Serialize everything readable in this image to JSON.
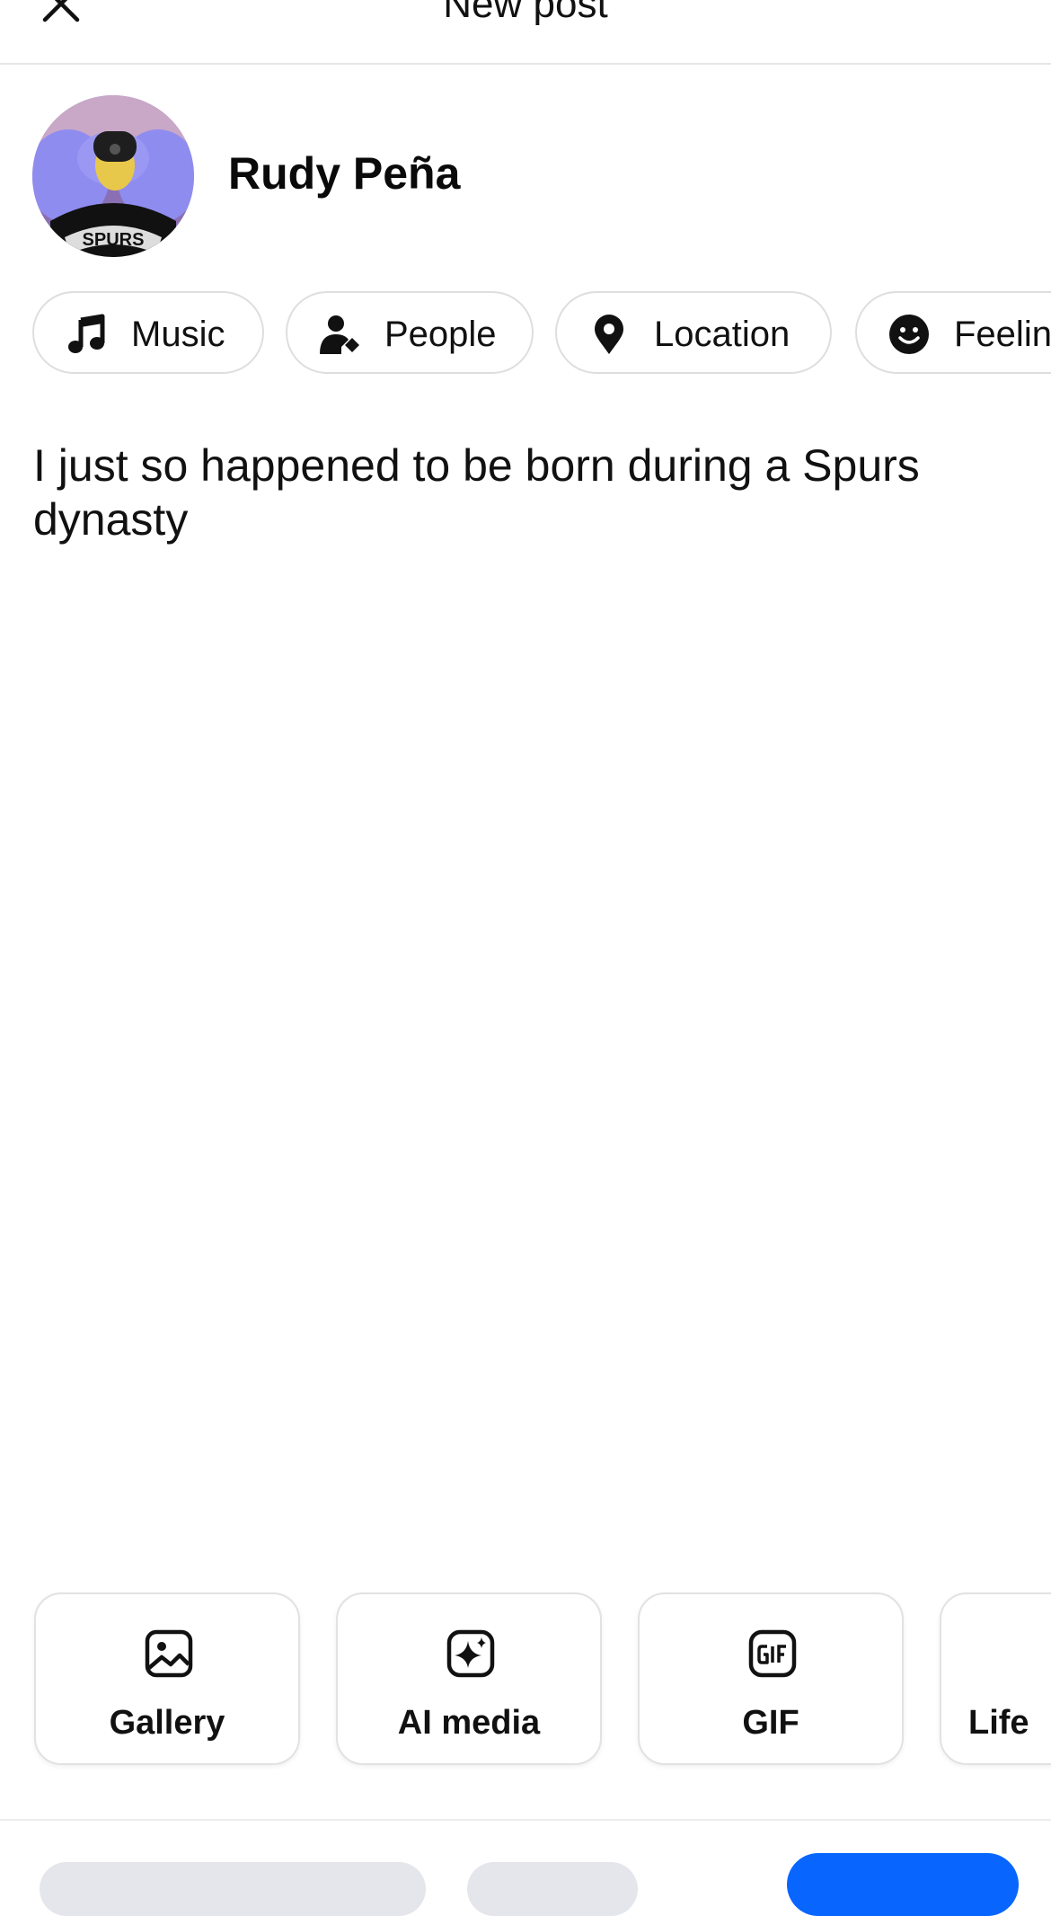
{
  "header": {
    "title": "New post",
    "close_icon": "close-icon"
  },
  "author": {
    "name": "Rudy Peña",
    "avatar_jersey_text": "SPURS"
  },
  "attachments": [
    {
      "label": "Music",
      "icon": "music-note-icon"
    },
    {
      "label": "People",
      "icon": "person-tag-icon"
    },
    {
      "label": "Location",
      "icon": "location-pin-icon"
    },
    {
      "label": "Feelin",
      "icon": "smiley-icon"
    }
  ],
  "post": {
    "text": "I just so happened to be born during a Spurs dynasty"
  },
  "media_options": [
    {
      "label": "Gallery",
      "icon": "gallery-icon"
    },
    {
      "label": "AI media",
      "icon": "ai-sparkle-icon"
    },
    {
      "label": "GIF",
      "icon": "gif-icon"
    },
    {
      "label": "Life",
      "icon": "life-event-icon"
    }
  ],
  "colors": {
    "accent": "#0866ff",
    "chip_border": "#dedede",
    "text": "#0a0a0a"
  }
}
